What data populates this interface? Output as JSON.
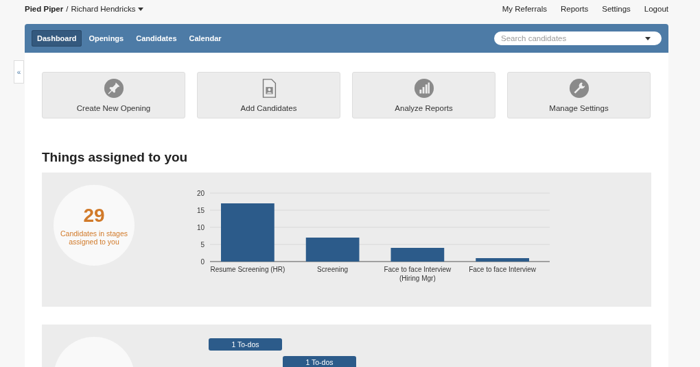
{
  "header": {
    "org": "Pied Piper",
    "separator": "/",
    "user": "Richard Hendricks",
    "links": [
      "My Referrals",
      "Reports",
      "Settings",
      "Logout"
    ]
  },
  "nav": {
    "tabs": [
      {
        "label": "Dashboard",
        "selected": true
      },
      {
        "label": "Openings",
        "selected": false
      },
      {
        "label": "Candidates",
        "selected": false
      },
      {
        "label": "Calendar",
        "selected": false
      }
    ],
    "search": {
      "placeholder": "Search candidates"
    }
  },
  "collapse_toggle": "«",
  "actions": [
    {
      "kind": "pin",
      "label": "Create New Opening"
    },
    {
      "kind": "document",
      "label": "Add Candidates"
    },
    {
      "kind": "chart",
      "label": "Analyze Reports"
    },
    {
      "kind": "wrench",
      "label": "Manage Settings"
    }
  ],
  "section_title": "Things assigned to you",
  "stages_panel": {
    "count": "29",
    "caption": "Candidates in stages assigned to you",
    "chart_data": {
      "type": "bar",
      "categories": [
        "Resume Screening (HR)",
        "Screening",
        "Face to face Interview (Hiring Mgr)",
        "Face to face Interview"
      ],
      "series": [
        {
          "color": "#2c5b8a",
          "values": [
            17,
            7,
            4,
            1
          ]
        }
      ],
      "ylim": [
        0,
        20
      ],
      "yticks": [
        0,
        5,
        10,
        15,
        20
      ],
      "grid": true
    }
  },
  "todos_panel": {
    "bars": [
      {
        "label": "1 To-dos"
      },
      {
        "label": "1 To-dos"
      }
    ]
  }
}
